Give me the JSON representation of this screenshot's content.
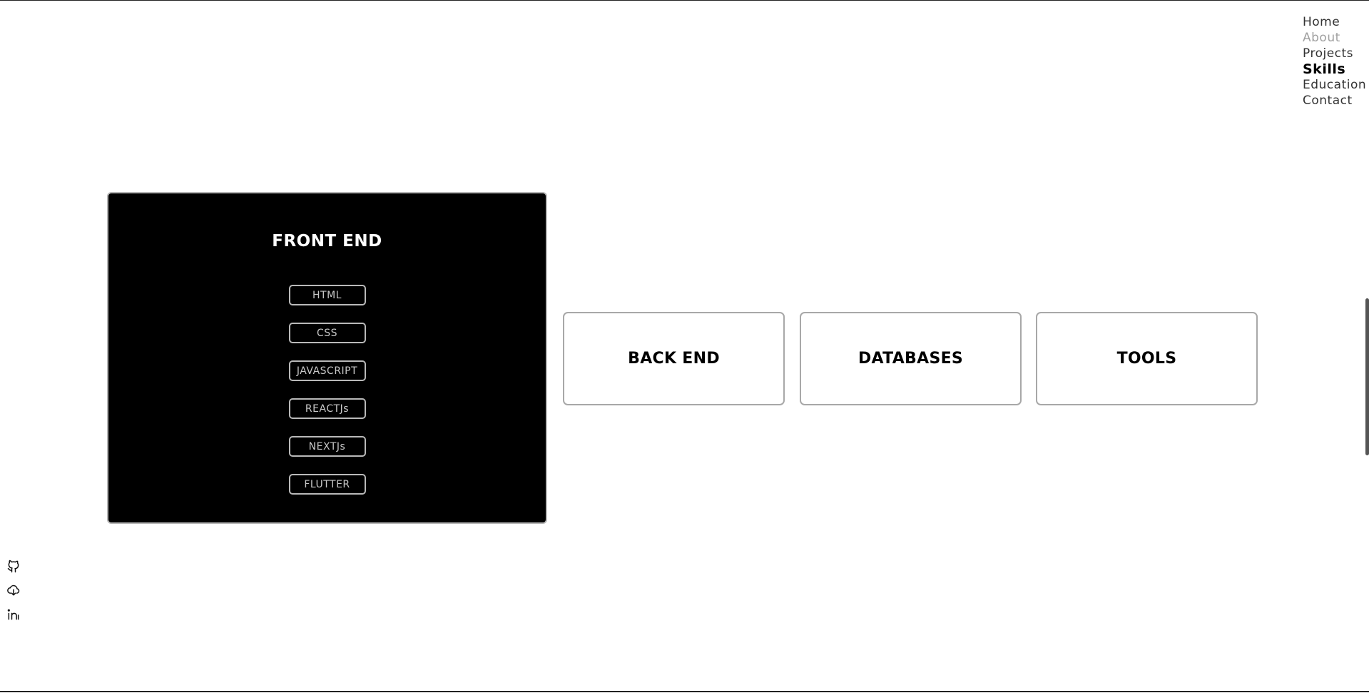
{
  "nav": {
    "items": [
      {
        "label": "Home",
        "state": "normal"
      },
      {
        "label": "About",
        "state": "muted"
      },
      {
        "label": "Projects",
        "state": "normal"
      },
      {
        "label": "Skills",
        "state": "active"
      },
      {
        "label": "Education",
        "state": "normal"
      },
      {
        "label": "Contact",
        "state": "normal"
      }
    ]
  },
  "skills": {
    "front_end": {
      "title": "FRONT END",
      "items": [
        "HTML",
        "CSS",
        "JAVASCRIPT",
        "REACTJs",
        "NEXTJs",
        "FLUTTER"
      ]
    },
    "back_end": {
      "title": "BACK END"
    },
    "databases": {
      "title": "DATABASES"
    },
    "tools": {
      "title": "TOOLS"
    }
  },
  "social": {
    "icons": [
      "github-icon",
      "cloud-download-icon",
      "linkedin-icon"
    ]
  },
  "colors": {
    "background": "#ffffff",
    "card_active_bg": "#000000",
    "border": "#a8a8a8",
    "nav_muted": "#a0a0a0"
  }
}
